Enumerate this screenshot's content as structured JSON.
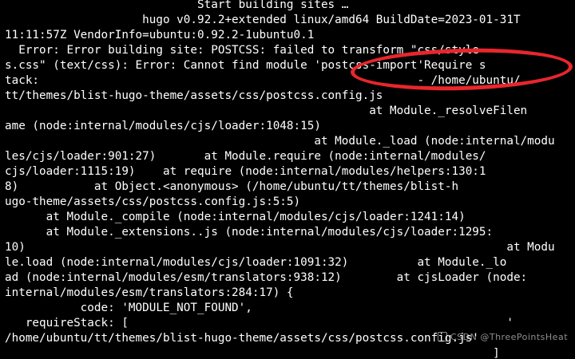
{
  "terminal": {
    "background": "#000000",
    "foreground": "#ffffff",
    "lines": [
      "                            Start building sites …",
      "                    hugo v0.92.2+extended linux/amd64 BuildDate=2023-01-31T",
      "11:11:57Z VendorInfo=ubuntu:0.92.2-1ubuntu0.1",
      "  Error: Error building site: POSTCSS: failed to transform \"css/style",
      "s.css\" (text/css): Error: Cannot find module 'postcss-import'Require s",
      "tack:                                                       - /home/ubuntu/",
      "tt/themes/blist-hugo-theme/assets/css/postcss.config.js",
      "                                                     at Module._resolveFilen",
      "ame (node:internal/modules/cjs/loader:1048:15)",
      "                                             at Module._load (node:internal/modu",
      "les/cjs/loader:901:27)       at Module.require (node:internal/modules/",
      "cjs/loader:1115:19)    at require (node:internal/modules/helpers:130:1",
      "8)           at Object.<anonymous> (/home/ubuntu/tt/themes/blist-h",
      "ugo-theme/assets/css/postcss.config.js:5:5)",
      "      at Module._compile (node:internal/modules/cjs/loader:1241:14)",
      "      at Module._extensions..js (node:internal/modules/cjs/loader:1295:",
      "10)                                                                      at Modu",
      "le.load (node:internal/modules/cjs/loader:1091:32)          at Module._lo",
      "ad (node:internal/modules/esm/translators:938:12)        at cjsLoader (node:",
      "internal/modules/esm/translators:284:17) {",
      "           code: 'MODULE_NOT_FOUND',",
      "   requireStack: [                                                       '",
      "/home/ubuntu/tt/themes/blist-hugo-theme/assets/css/postcss.config.js'",
      "                                                                       ]"
    ]
  },
  "annotation": {
    "color": "#e8262d",
    "highlighted_text": "'postcss-import'"
  },
  "watermark": {
    "text": "CSDN @ThreePointsHeat"
  }
}
